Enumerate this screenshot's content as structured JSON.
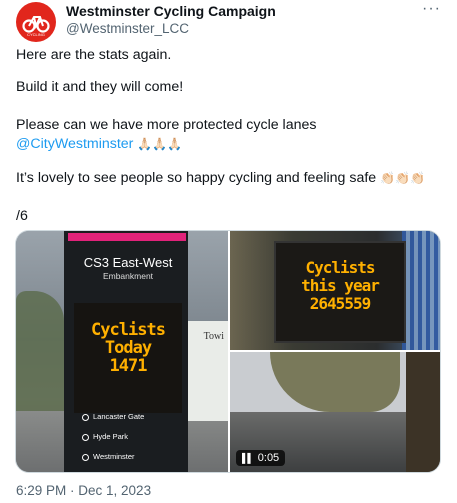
{
  "author": {
    "display_name": "Westminster Cycling Campaign",
    "handle": "@Westminster_LCC",
    "avatar_icon": "bicycle-logo-icon",
    "brand_color": "#e1261c"
  },
  "more_label": "···",
  "tweet": {
    "line1": "Here are the stats again.",
    "line2": "Build it and they will come!",
    "line3_before": "Please can we have more protected cycle lanes ",
    "mention": "@CityWestminster",
    "line3_emoji": " 🙏🏻🙏🏻🙏🏻",
    "line4": "It’s lovely to see people so happy cycling and feeling safe ",
    "line4_emoji": "👏🏻👏🏻👏🏻",
    "line5": "/6"
  },
  "media": {
    "photo1": {
      "sign_title": "CS3 East-West",
      "sign_subtitle": "Embankment",
      "led_line1": "Cyclists",
      "led_line2": "Today",
      "led_line3": "1471",
      "stops": [
        "Lancaster Gate",
        "Hyde Park",
        "Westminster"
      ],
      "bus_label": "Towi"
    },
    "photo2": {
      "led_line1": "Cyclists",
      "led_line2": "this year",
      "led_line3": "2645559"
    },
    "video": {
      "duration": "0:05",
      "pause_icon": "pause-icon"
    }
  },
  "timestamp": "6:29 PM · Dec 1, 2023",
  "colors": {
    "led": "#ffb000",
    "link": "#1d9bf0",
    "muted": "#536471"
  }
}
